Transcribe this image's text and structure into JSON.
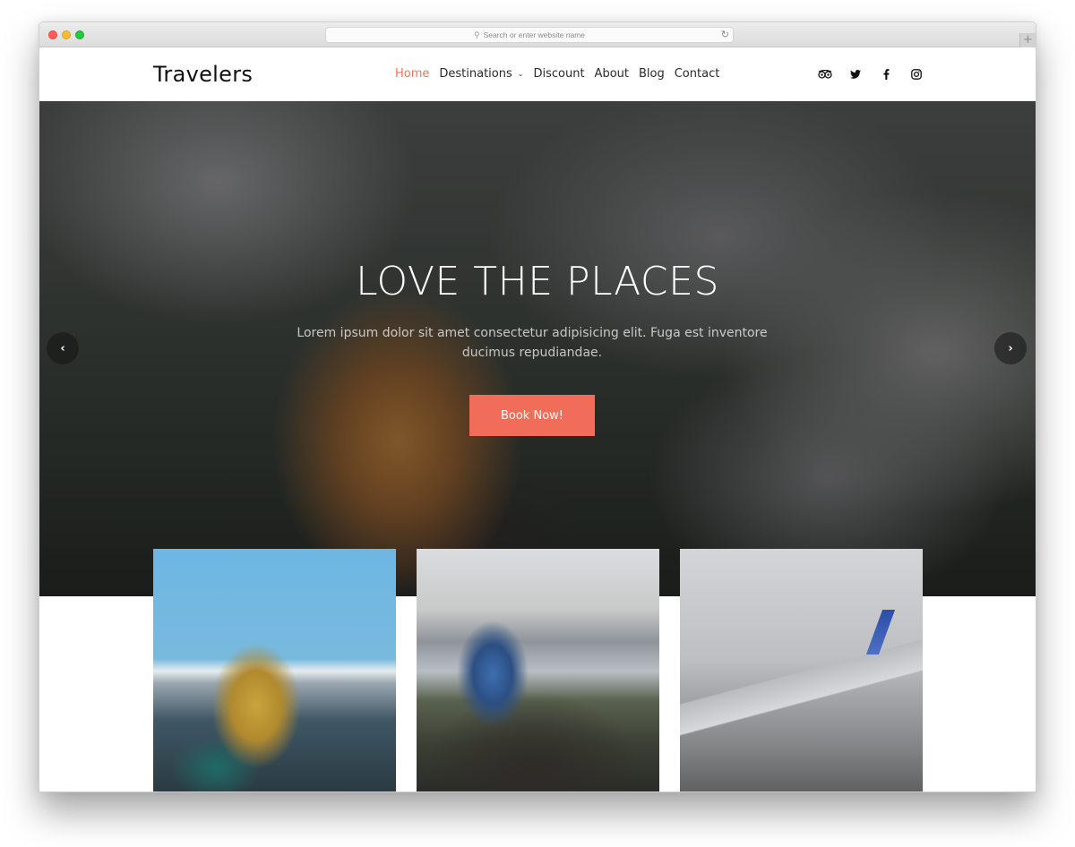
{
  "browser": {
    "address_placeholder": "Search or enter website name",
    "icons": {
      "search": "search-icon",
      "reload": "reload-icon",
      "new_tab": "plus-icon"
    }
  },
  "site": {
    "logo": "Travelers",
    "nav": [
      {
        "label": "Home",
        "active": true
      },
      {
        "label": "Destinations",
        "has_dropdown": true
      },
      {
        "label": "Discount"
      },
      {
        "label": "About"
      },
      {
        "label": "Blog"
      },
      {
        "label": "Contact"
      }
    ],
    "social": [
      "tripadvisor-icon",
      "twitter-icon",
      "facebook-icon",
      "instagram-icon"
    ],
    "accent_color": "#f26d59"
  },
  "hero": {
    "title": "LOVE THE PLACES",
    "subtitle": "Lorem ipsum dolor sit amet consectetur adipisicing elit. Fuga est inventore ducimus repudiandae.",
    "cta": "Book Now!",
    "prev_arrow": "‹",
    "next_arrow": "›"
  },
  "cards": [
    {
      "subject": "Hiker with yellow jacket sitting by snowy mountains"
    },
    {
      "subject": "Photographer on rock above cloud-filled valley"
    },
    {
      "subject": "Airplane wing above clouds"
    }
  ]
}
